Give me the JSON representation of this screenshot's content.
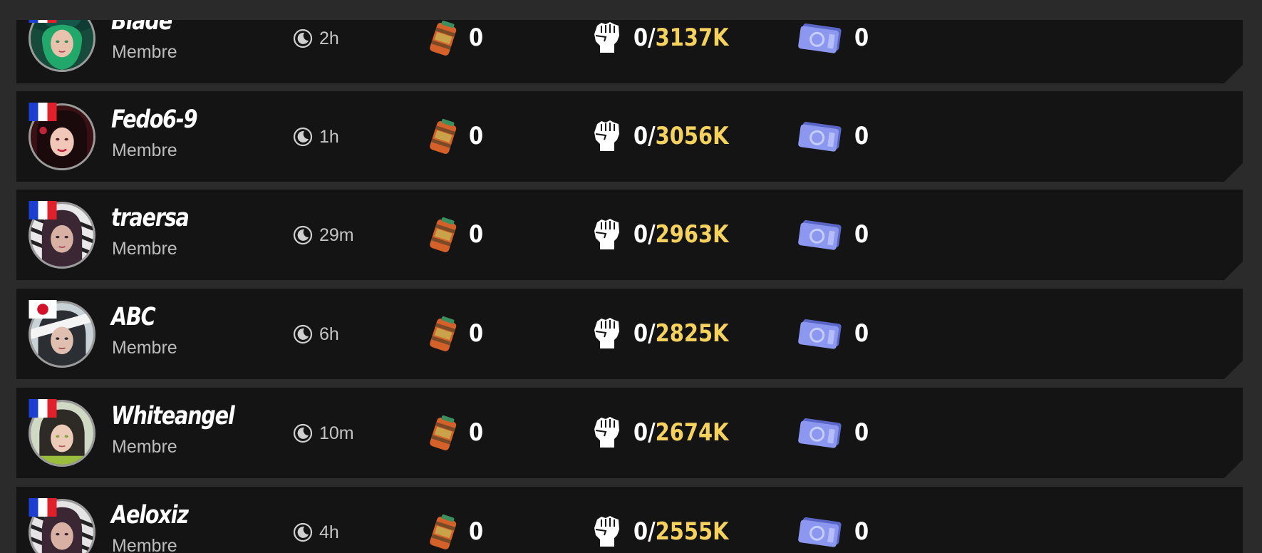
{
  "colors": {
    "background": "#2b2b2b",
    "row": "#141414",
    "accent_power": "#f5d25d",
    "role_text": "#bdbdbd"
  },
  "icons": {
    "time": "moon-clock-icon",
    "fuel": "fuel-barrel-icon",
    "power": "fist-icon",
    "tickets": "ticket-icon",
    "flag_fr": "france-flag-icon",
    "flag_jp": "japan-flag-icon"
  },
  "members": [
    {
      "name": "Blade",
      "role": "Membre",
      "flag": "fr",
      "time": "2h",
      "fuel": "0",
      "power_current": "0",
      "power_sep": "/",
      "power_max": "3137K",
      "tickets": "0"
    },
    {
      "name": "Fedo6-9",
      "role": "Membre",
      "flag": "fr",
      "time": "1h",
      "fuel": "0",
      "power_current": "0",
      "power_sep": "/",
      "power_max": "3056K",
      "tickets": "0"
    },
    {
      "name": "traersa",
      "role": "Membre",
      "flag": "fr",
      "time": "29m",
      "fuel": "0",
      "power_current": "0",
      "power_sep": "/",
      "power_max": "2963K",
      "tickets": "0"
    },
    {
      "name": "ABC",
      "role": "Membre",
      "flag": "jp",
      "time": "6h",
      "fuel": "0",
      "power_current": "0",
      "power_sep": "/",
      "power_max": "2825K",
      "tickets": "0"
    },
    {
      "name": "Whiteangel",
      "role": "Membre",
      "flag": "fr",
      "time": "10m",
      "fuel": "0",
      "power_current": "0",
      "power_sep": "/",
      "power_max": "2674K",
      "tickets": "0"
    },
    {
      "name": "Aeloxiz",
      "role": "Membre",
      "flag": "fr",
      "time": "4h",
      "fuel": "0",
      "power_current": "0",
      "power_sep": "/",
      "power_max": "2555K",
      "tickets": "0"
    }
  ]
}
